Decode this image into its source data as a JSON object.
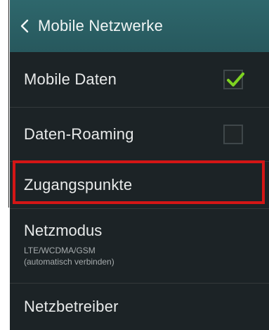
{
  "header": {
    "back_icon": "chevron-left-icon",
    "title": "Mobile Netzwerke"
  },
  "settings": {
    "mobile_data": {
      "label": "Mobile Daten",
      "checked": true
    },
    "data_roaming": {
      "label": "Daten-Roaming",
      "checked": false
    },
    "access_points": {
      "label": "Zugangspunkte",
      "highlighted": true
    },
    "network_mode": {
      "label": "Netzmodus",
      "value_line1": "LTE/WCDMA/GSM",
      "value_line2": "(automatisch verbinden)"
    },
    "network_operator": {
      "label": "Netzbetreiber"
    }
  },
  "colors": {
    "header_bg": "#2e676c",
    "screen_bg": "#1c2326",
    "check_green": "#7ed321",
    "highlight_red": "#d41616"
  }
}
